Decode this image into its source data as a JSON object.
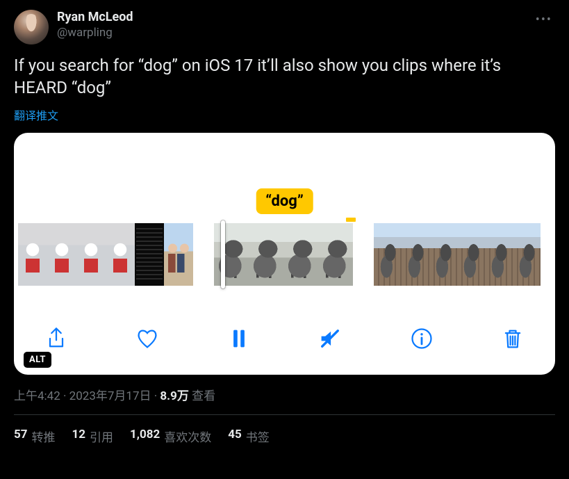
{
  "author": {
    "display_name": "Ryan McLeod",
    "handle": "@warpling"
  },
  "body_text": "If you search for “dog” on iOS 17 it’ll also show you clips where it’s HEARD “dog”",
  "translate_label": "翻译推文",
  "media": {
    "search_tag": "“dog”",
    "alt_badge": "ALT"
  },
  "toolbar": {
    "share": "share",
    "like": "like",
    "pause": "pause",
    "mute": "mute",
    "info": "info",
    "trash": "trash"
  },
  "meta": {
    "time": "上午4:42",
    "sep1": " · ",
    "date": "2023年7月17日",
    "sep2": " · ",
    "views_count": "8.9万",
    "views_label": " 查看"
  },
  "stats": {
    "retweets": {
      "count": "57",
      "label": "转推"
    },
    "quotes": {
      "count": "12",
      "label": "引用"
    },
    "likes": {
      "count": "1,082",
      "label": "喜欢次数"
    },
    "bookmarks": {
      "count": "45",
      "label": "书签"
    }
  }
}
